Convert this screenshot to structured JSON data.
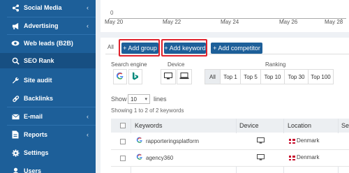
{
  "sidebar": {
    "items": [
      {
        "label": "Social Media",
        "icon": "share-icon",
        "chevron": "‹"
      },
      {
        "label": "Advertising",
        "icon": "megaphone-icon",
        "chevron": "‹"
      },
      {
        "label": "Web leads (B2B)",
        "icon": "eye-icon",
        "chevron": ""
      },
      {
        "label": "SEO Rank",
        "icon": "search-icon",
        "chevron": ""
      },
      {
        "label": "Site audit",
        "icon": "wrench-icon",
        "chevron": ""
      },
      {
        "label": "Backlinks",
        "icon": "link-icon",
        "chevron": ""
      },
      {
        "label": "E-mail",
        "icon": "envelope-icon",
        "chevron": "‹"
      },
      {
        "label": "Reports",
        "icon": "report-icon",
        "chevron": "‹"
      },
      {
        "label": "Settings",
        "icon": "gear-icon",
        "chevron": ""
      },
      {
        "label": "Users",
        "icon": "user-icon",
        "chevron": ""
      }
    ],
    "active_index": 3
  },
  "chart": {
    "y_zero_label": "0",
    "x_labels": [
      "May 20",
      "May 22",
      "May 24",
      "May 26",
      "May 28"
    ]
  },
  "tabs": {
    "all_label": "All"
  },
  "toolbar": {
    "add_group_label": "+ Add group",
    "add_keyword_label": "+ Add keyword",
    "add_competitor_label": "+ Add competitor"
  },
  "filters": {
    "search_engine_label": "Search engine",
    "device_label": "Device",
    "ranking_label": "Ranking",
    "ranking_options": [
      "All",
      "Top 1",
      "Top 5",
      "Top 10",
      "Top 30",
      "Top 100"
    ],
    "ranking_selected": "All"
  },
  "table_controls": {
    "show_label": "Show",
    "lines_value": "10",
    "lines_label": "lines",
    "showing_text": "Showing 1 to 2 of 2 keywords"
  },
  "table": {
    "columns": [
      "Keywords",
      "Device",
      "Location",
      "Se"
    ],
    "rows": [
      {
        "keyword": "rapporteringsplatform",
        "device": "desktop-icon",
        "location": "Denmark"
      },
      {
        "keyword": "agency360",
        "device": "desktop-icon",
        "location": "Denmark"
      }
    ]
  },
  "colors": {
    "sidebar_bg": "#1d5f99",
    "button_bg": "#1d5f99",
    "highlight": "#e0212b"
  }
}
